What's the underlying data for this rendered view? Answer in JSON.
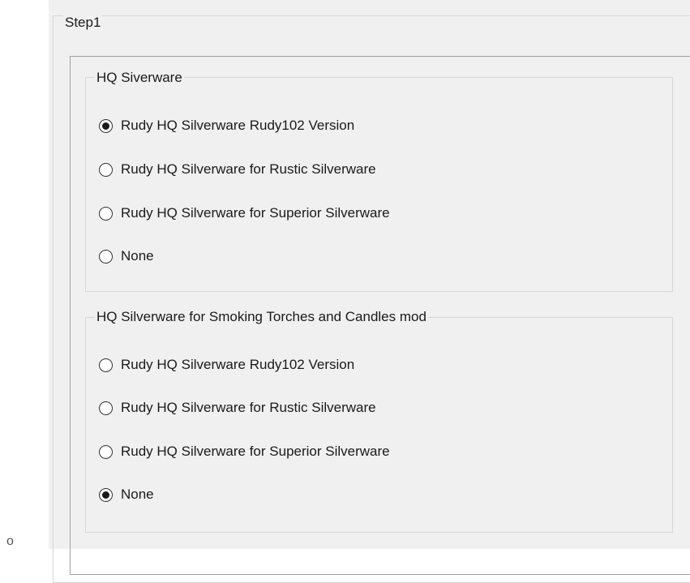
{
  "step": {
    "title": "Step1"
  },
  "groups": [
    {
      "title": "HQ Siverware",
      "options": [
        {
          "label": "Rudy HQ Silverware Rudy102 Version",
          "checked": true
        },
        {
          "label": "Rudy HQ Silverware for Rustic Silverware",
          "checked": false
        },
        {
          "label": "Rudy HQ Silverware for Superior Silverware",
          "checked": false
        },
        {
          "label": "None",
          "checked": false
        }
      ]
    },
    {
      "title": "HQ Silverware for Smoking Torches and Candles mod",
      "options": [
        {
          "label": "Rudy HQ Silverware Rudy102 Version",
          "checked": false
        },
        {
          "label": "Rudy HQ Silverware for Rustic Silverware",
          "checked": false
        },
        {
          "label": "Rudy HQ Silverware for Superior Silverware",
          "checked": false
        },
        {
          "label": "None",
          "checked": true
        }
      ]
    }
  ],
  "stray_glyph": "o"
}
